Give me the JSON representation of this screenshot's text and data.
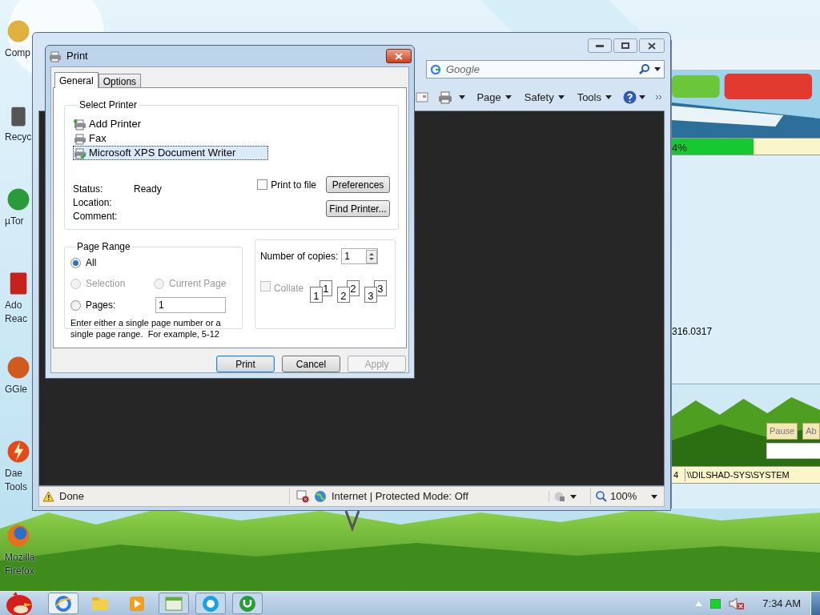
{
  "desktop_icons": [
    {
      "kind": "computer",
      "lines": [
        "Comp"
      ]
    },
    {
      "kind": "recycle",
      "lines": [
        "Recyc"
      ]
    },
    {
      "kind": "torrent",
      "lines": [
        "µTor"
      ]
    },
    {
      "kind": "pdf",
      "lines": [
        "Ado",
        "Reac"
      ]
    },
    {
      "kind": "disc",
      "lines": [
        "GGle"
      ]
    },
    {
      "kind": "bolt",
      "lines": [
        "Dae",
        "Tools"
      ]
    },
    {
      "kind": "browser",
      "lines": [
        "Mozilla",
        "Firefox"
      ]
    }
  ],
  "installer": {
    "progress": {
      "reading": "4%",
      "level": 0.55
    },
    "value": "316.0317",
    "buttons": [
      "Pause",
      "Ab"
    ],
    "path_row": [
      "4",
      "\\\\DILSHAD-SYS\\SYSTEM"
    ]
  },
  "browser": {
    "search": {
      "placeholder": "Google"
    },
    "menus": [
      "Page",
      "Safety",
      "Tools"
    ],
    "status": {
      "text": "Done",
      "zone": "Internet | Protected Mode: Off",
      "zoom": "100%"
    }
  },
  "print_dialog": {
    "title": "Print",
    "tabs": [
      {
        "label": "General",
        "selected": true
      },
      {
        "label": "Options",
        "selected": false
      }
    ],
    "select_printer": {
      "heading": "Select Printer",
      "printers": [
        {
          "kind": "add",
          "name": "Add Printer",
          "selected": false
        },
        {
          "kind": "fax",
          "name": "Fax",
          "selected": false
        },
        {
          "kind": "xps",
          "name": "Microsoft XPS Document Writer",
          "selected": true
        }
      ],
      "info": [
        {
          "label": "Status:",
          "value": "Ready"
        },
        {
          "label": "Location:"
        },
        {
          "label": "Comment:"
        }
      ],
      "print_to_file": {
        "label": "Print to file",
        "checked": false
      },
      "buttons": [
        "Preferences",
        "Find Printer..."
      ]
    },
    "page_range": {
      "heading": "Page Range",
      "options": [
        {
          "label": "All",
          "selected": true,
          "disabled": false
        },
        {
          "label": "Selection",
          "selected": false,
          "disabled": true
        },
        {
          "label": "Current Page",
          "selected": false,
          "disabled": true
        },
        {
          "label": "Pages:",
          "selected": false,
          "disabled": false
        }
      ],
      "pages_value": "1",
      "hint": "Enter either a single page number or a single page range.  For example, 5-12"
    },
    "copies": {
      "label": "Number of copies:",
      "value": "1",
      "collate": {
        "label": "Collate",
        "checked": false,
        "disabled": true
      },
      "collate_pages": [
        "1",
        "1",
        "2",
        "2",
        "3",
        "3"
      ]
    },
    "buttons": [
      {
        "label": "Print",
        "default": true,
        "disabled": false
      },
      {
        "label": "Cancel",
        "default": false,
        "disabled": false
      },
      {
        "label": "Apply",
        "default": false,
        "disabled": true
      }
    ]
  },
  "taskbar": {
    "items": [
      {
        "kind": "browser",
        "running": true,
        "selected": true
      },
      {
        "kind": "folder",
        "running": false,
        "selected": false
      },
      {
        "kind": "media",
        "running": false,
        "selected": false
      },
      {
        "kind": "window",
        "running": true,
        "selected": false
      },
      {
        "kind": "chat",
        "running": true,
        "selected": false
      },
      {
        "kind": "torrent",
        "running": true,
        "selected": false
      }
    ],
    "tray": {
      "muted": true,
      "clock": "7:34 AM"
    }
  }
}
